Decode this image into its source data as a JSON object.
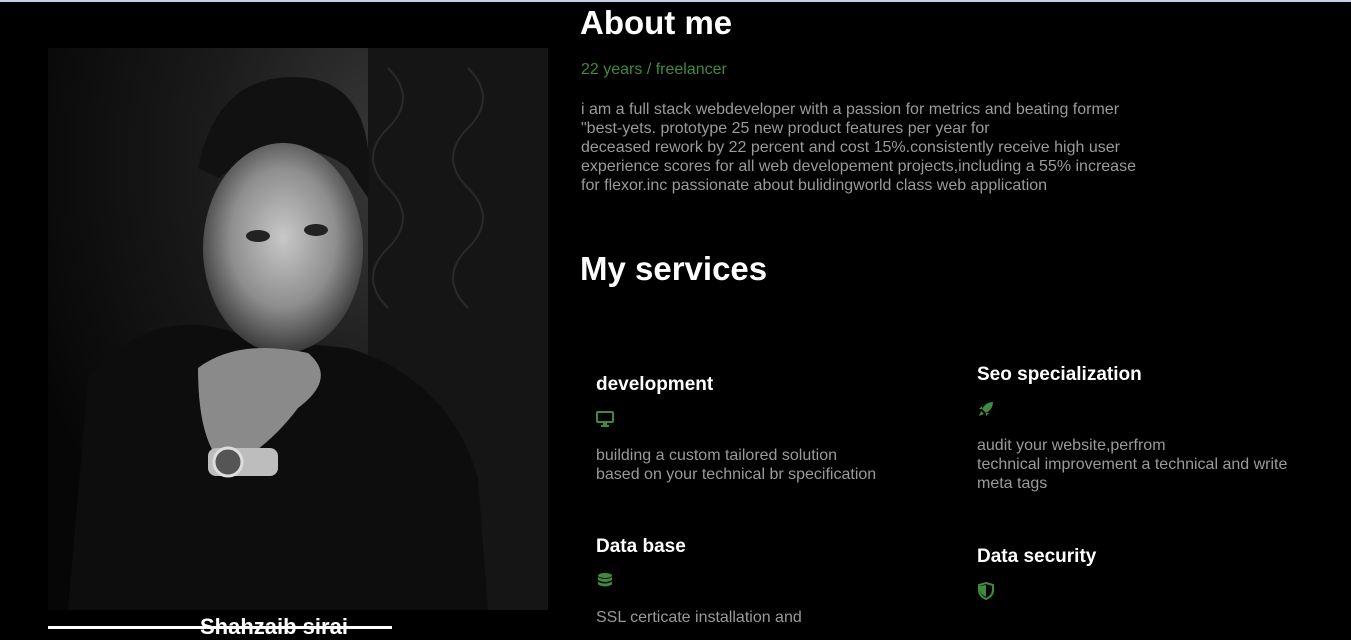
{
  "about": {
    "heading": "About me",
    "tagline": "22 years / freelancer",
    "bio_lines": [
      "i am a full stack webdeveloper with a passion for metrics and beating former",
      "\"best-yets. prototype 25 new product features per year for",
      "deceased rework by 22 percent and cost 15%.consistently receive high user",
      "experience scores for all web developement projects,including a 55% increase",
      "for flexor.inc passionate about bulidingworld class web application"
    ]
  },
  "profile": {
    "name": "Shahzaib sirai"
  },
  "services": {
    "heading": "My services",
    "items": [
      {
        "title": "development",
        "icon": "monitor-icon",
        "desc": [
          "building a custom tailored solution",
          "based on your technical br specification"
        ]
      },
      {
        "title": "Seo specialization",
        "icon": "rocket-icon",
        "desc": [
          "audit your website,perfrom",
          "technical improvement a technical and write",
          "meta tags"
        ]
      },
      {
        "title": "Data base",
        "icon": "database-icon",
        "desc": [
          "SSL certicate installation and"
        ]
      },
      {
        "title": "Data security",
        "icon": "shield-icon",
        "desc": []
      }
    ]
  },
  "colors": {
    "background": "#000000",
    "accent": "#3f8a3f",
    "text_muted": "#9a9a9a",
    "heading": "#ffffff"
  }
}
